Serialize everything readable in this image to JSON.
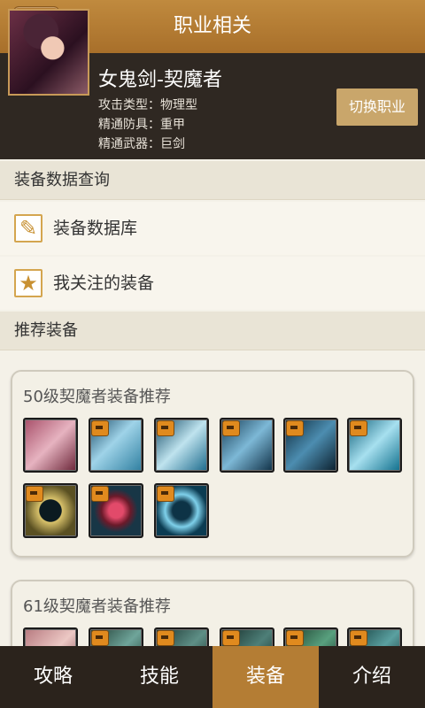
{
  "header": {
    "title": "职业相关",
    "menu_icon": "menu-icon"
  },
  "profile": {
    "class_name": "女鬼剑-契魔者",
    "attack_type": "攻击类型：物理型",
    "armor": "精通防具：重甲",
    "weapon": "精通武器：巨剑",
    "switch_label": "切换职业"
  },
  "sections": {
    "equip_query": "装备数据查询",
    "recommend": "推荐装备"
  },
  "list_items": [
    {
      "label": "装备数据库",
      "icon": "feather-icon"
    },
    {
      "label": "我关注的装备",
      "icon": "star-icon"
    }
  ],
  "cards": [
    {
      "title": "50级契魔者装备推荐",
      "item_count": 9
    },
    {
      "title": "61级契魔者装备推荐",
      "item_count": 6
    }
  ],
  "tabs": [
    {
      "label": "攻略",
      "active": false
    },
    {
      "label": "技能",
      "active": false
    },
    {
      "label": "装备",
      "active": true
    },
    {
      "label": "介绍",
      "active": false
    }
  ],
  "colors": {
    "accent": "#b47d34",
    "topbar": "#b27a34",
    "dark": "#2b231c"
  }
}
